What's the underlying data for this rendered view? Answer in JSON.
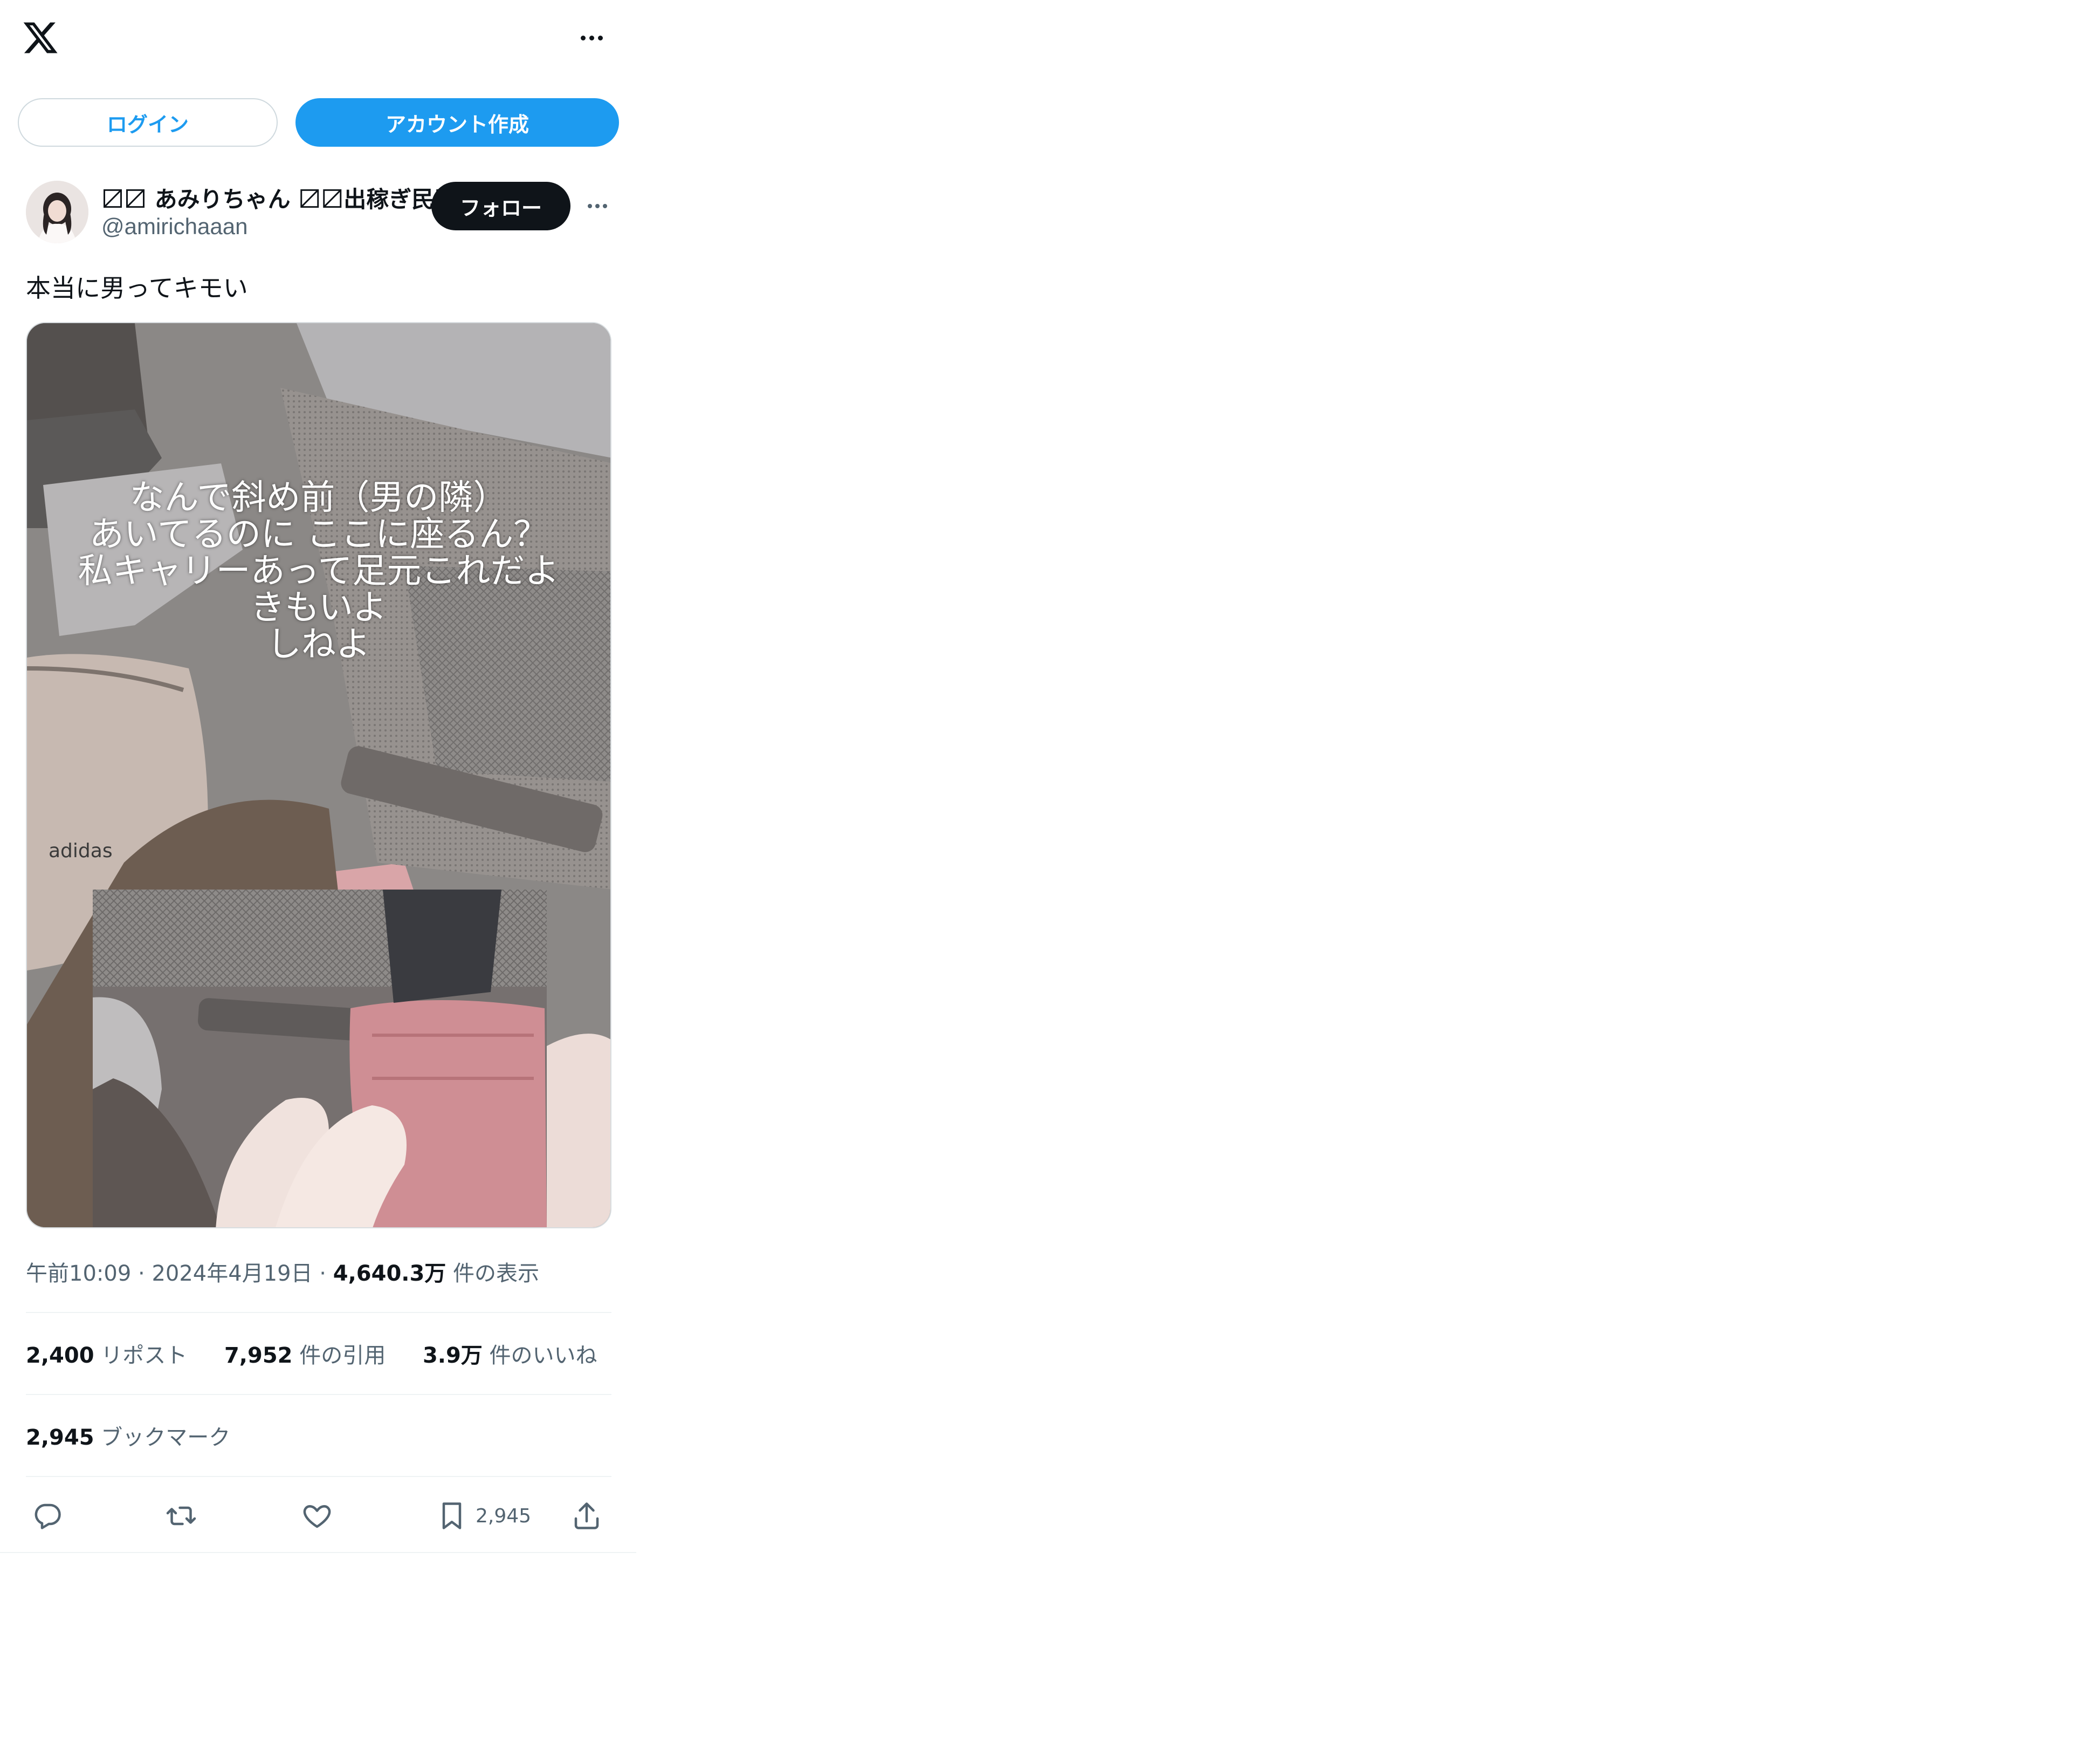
{
  "header": {
    "logo_icon": "x-logo-icon",
    "more_icon": "more-horizontal-icon"
  },
  "auth": {
    "login_label": "ログイン",
    "signup_label": "アカウント作成"
  },
  "tweet": {
    "author": {
      "display_name": "〼〼 あみりちゃん 〼〼出稼ぎ民〼〼",
      "handle": "@amirichaaan",
      "follow_label": "フォロー"
    },
    "text": "本当に男ってキモい",
    "media": {
      "overlay_lines": [
        "なんで斜め前（男の隣）",
        "あいてるのに ここに座るん？",
        "私キャリーあって足元これだよ",
        "きもいよ",
        "しねよ"
      ],
      "brand_text": "adidas"
    },
    "meta": {
      "time": "午前10:09",
      "date": "2024年4月19日",
      "views_count": "4,640.3万",
      "views_label": "件の表示"
    },
    "stats": {
      "reposts_count": "2,400",
      "reposts_label": "リポスト",
      "quotes_count": "7,952",
      "quotes_label": "件の引用",
      "likes_count": "3.9万",
      "likes_label": "件のいいね",
      "bookmarks_count": "2,945",
      "bookmarks_label": "ブックマーク"
    },
    "actions": {
      "bookmark_count": "2,945"
    }
  },
  "colors": {
    "accent": "#1d9bf0",
    "text": "#0f1419",
    "secondary": "#536471",
    "divider": "#eff3f4"
  }
}
